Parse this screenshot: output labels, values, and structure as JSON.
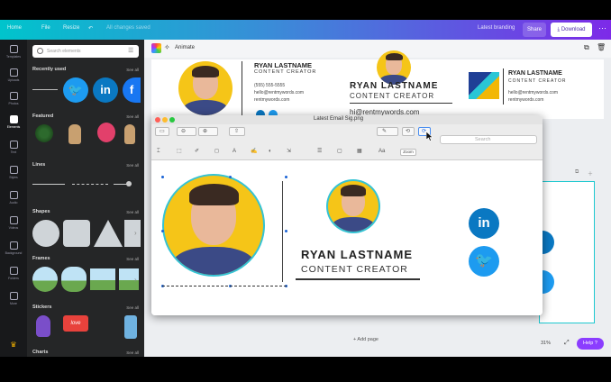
{
  "topbar": {
    "home": "Home",
    "file": "File",
    "resize": "Resize",
    "status": "All changes saved",
    "title": "Latest branding",
    "share": "Share",
    "download": "Download",
    "gradient_start": "#00c4cc",
    "gradient_end": "#7d2ae8"
  },
  "rail": {
    "items": [
      {
        "label": "Templates",
        "icon": "templates-icon"
      },
      {
        "label": "Uploads",
        "icon": "upload-icon"
      },
      {
        "label": "Photos",
        "icon": "photos-icon"
      },
      {
        "label": "Elements",
        "icon": "elements-icon"
      },
      {
        "label": "Text",
        "icon": "text-icon"
      },
      {
        "label": "Styles",
        "icon": "styles-icon"
      },
      {
        "label": "Audio",
        "icon": "audio-icon"
      },
      {
        "label": "Videos",
        "icon": "videos-icon"
      },
      {
        "label": "Background",
        "icon": "background-icon"
      },
      {
        "label": "Folders",
        "icon": "folder-icon"
      },
      {
        "label": "More",
        "icon": "more-icon"
      }
    ],
    "active_index": 3
  },
  "panel": {
    "search_placeholder": "Search elements",
    "see_all": "See all",
    "sections": {
      "recently_used": "Recently used",
      "featured": "Featured",
      "lines": "Lines",
      "shapes": "Shapes",
      "frames": "Frames",
      "stickers": "Stickers",
      "charts": "Charts"
    },
    "sticker_text": "love",
    "twitter_glyph": "🐦",
    "linkedin_glyph": "in",
    "facebook_glyph": "f"
  },
  "editor": {
    "animate_label": "Animate",
    "add_page": "+ Add page",
    "zoom": "31%",
    "help": "Help ?",
    "signature_top": {
      "name": "RYAN LASTNAME",
      "role": "CONTENT CREATOR",
      "phone": "(555) 555-5555",
      "email": "hello@rentmywords.com",
      "site": "rentmywords.com",
      "url_big": "hi@rentmywords.com",
      "brand_email": "hello@rentmywords.com",
      "brand_site": "rentmywords.com"
    }
  },
  "preview": {
    "window_title": "Latest Email Sig.png",
    "search_placeholder": "Search",
    "zoom_box": "Zoom",
    "name": "RYAN LASTNAME",
    "role": "CONTENT CREATOR",
    "linkedin_glyph": "in",
    "twitter_glyph": "🐦",
    "close_color": "#ff5f57",
    "min_color": "#febc2e",
    "max_color": "#28c840"
  }
}
